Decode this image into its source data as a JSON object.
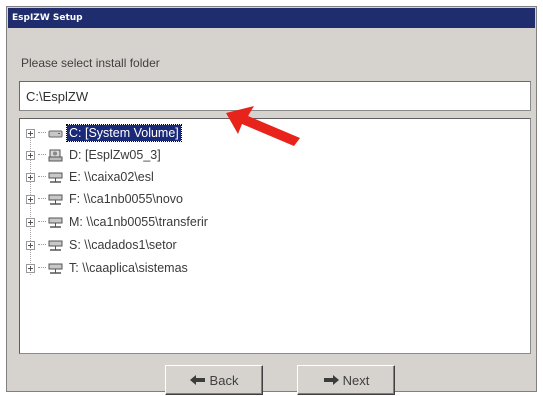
{
  "window": {
    "title": "EspIZW Setup"
  },
  "prompt": "Please select install folder",
  "path_input": {
    "value": "C:\\EsplZW"
  },
  "tree": {
    "items": [
      {
        "label": "C: [System Volume]",
        "icon": "hard-drive-icon",
        "selected": true
      },
      {
        "label": "D: [EsplZw05_3]",
        "icon": "cd-drive-icon",
        "selected": false
      },
      {
        "label": "E: \\\\caixa02\\esl",
        "icon": "network-drive-icon",
        "selected": false
      },
      {
        "label": "F: \\\\ca1nb0055\\novo",
        "icon": "network-drive-icon",
        "selected": false
      },
      {
        "label": "M: \\\\ca1nb0055\\transferir",
        "icon": "network-drive-icon",
        "selected": false
      },
      {
        "label": "S: \\\\cadados1\\setor",
        "icon": "network-drive-icon",
        "selected": false
      },
      {
        "label": "T: \\\\caaplica\\sistemas",
        "icon": "network-drive-icon",
        "selected": false
      }
    ]
  },
  "buttons": {
    "back": "Back",
    "next": "Next"
  },
  "colors": {
    "titlebar": "#1f2d6e",
    "selection": "#1b2a78",
    "annotation_arrow": "#e8231c"
  }
}
